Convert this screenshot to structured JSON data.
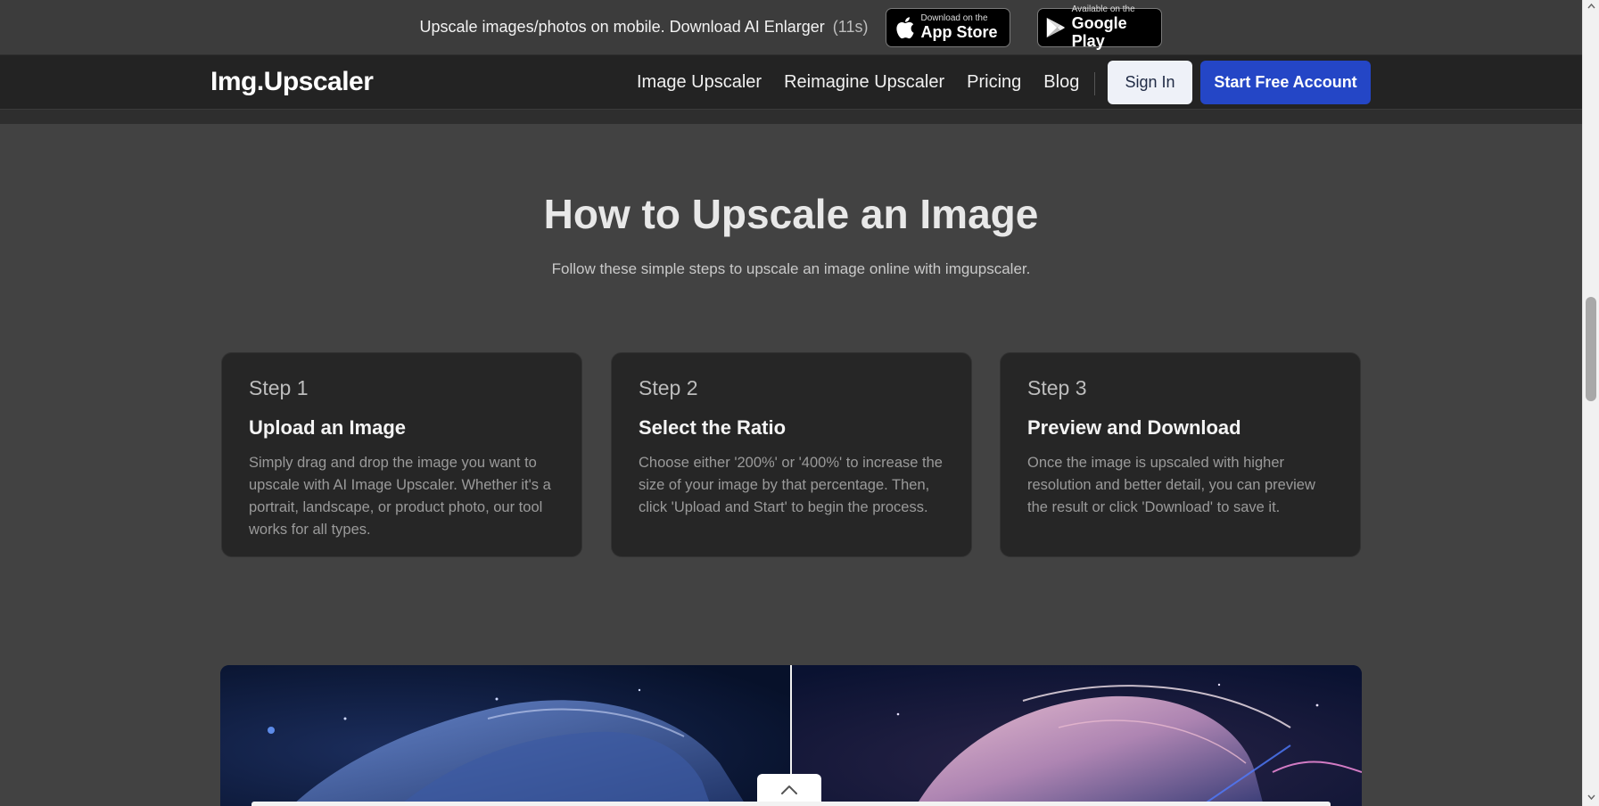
{
  "topbar": {
    "text": "Upscale images/photos on mobile. Download AI Enlarger",
    "countdown": "(11s)",
    "app_store": {
      "small": "Download on the",
      "big": "App Store"
    },
    "google_play": {
      "small": "Available on the",
      "big": "Google Play"
    }
  },
  "nav": {
    "logo": "Img.Upscaler",
    "links": [
      "Image Upscaler",
      "Reimagine Upscaler",
      "Pricing",
      "Blog"
    ],
    "sign_in": "Sign In",
    "start_free": "Start Free Account"
  },
  "section": {
    "title": "How to Upscale an Image",
    "subtitle": "Follow these simple steps to upscale an image online with imgupscaler."
  },
  "steps": [
    {
      "step": "Step 1",
      "title": "Upload an Image",
      "description": "Simply drag and drop the image you want to upscale with AI Image Upscaler. Whether it's a portrait, landscape, or product photo, our tool works for all types."
    },
    {
      "step": "Step 2",
      "title": "Select the Ratio",
      "description": "Choose either '200%' or '400%' to increase the size of your image by that percentage. Then, click 'Upload and Start' to begin the process."
    },
    {
      "step": "Step 3",
      "title": "Preview and Download",
      "description": "Once the image is upscaled with higher resolution and better detail, you can preview the result or click 'Download' to save it."
    }
  ],
  "colors": {
    "page_bg": "#424242",
    "nav_bg": "#232323",
    "card_bg": "#262626",
    "accent": "#2446c6"
  },
  "icons": {
    "apple": "apple-logo-icon",
    "google_play": "google-play-logo-icon",
    "chevron_up": "chevron-up-icon"
  }
}
